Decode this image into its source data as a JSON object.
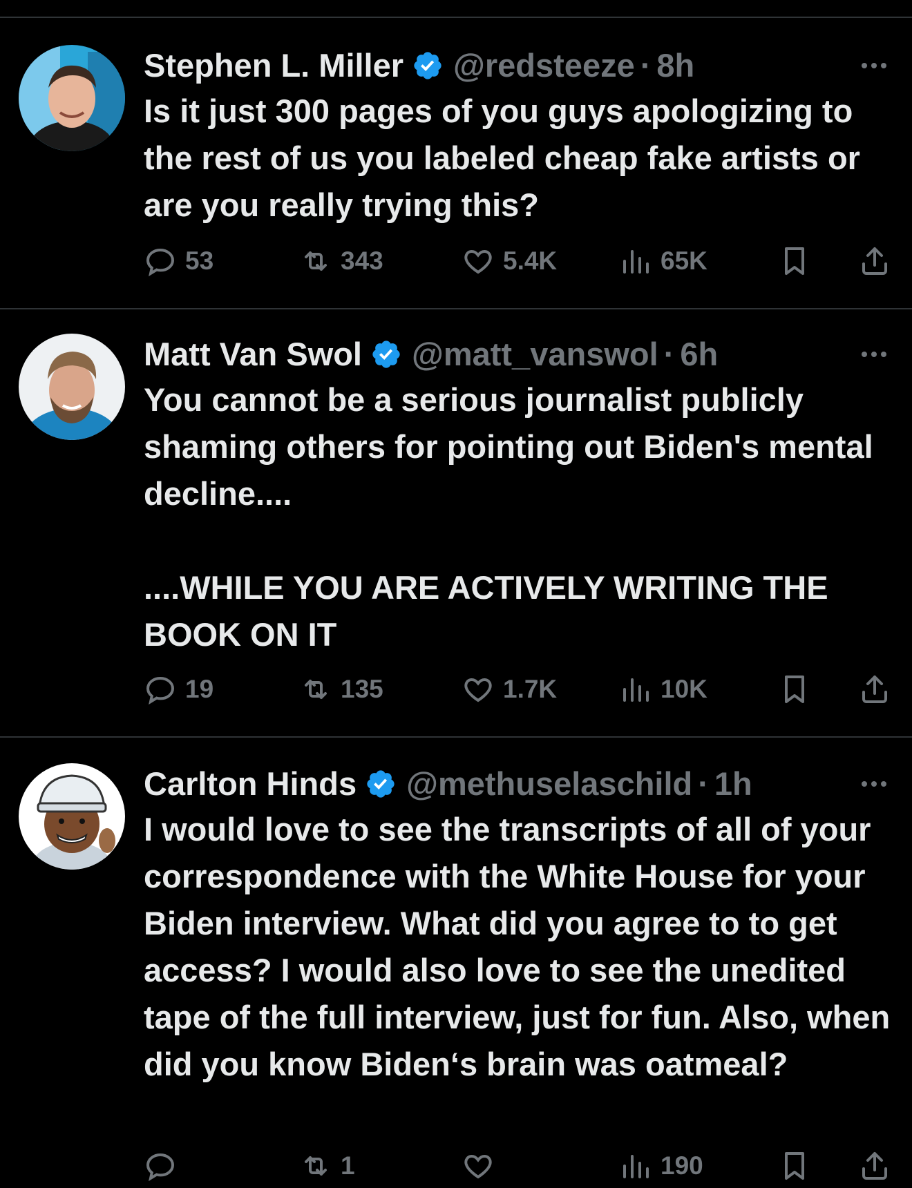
{
  "tweets": [
    {
      "name": "Stephen L. Miller",
      "handle": "@redsteeze",
      "time": "8h",
      "text": "Is it just 300 pages of you guys apologizing to the rest of us you labeled cheap fake artists or are you really trying this?",
      "replies": "53",
      "reposts": "343",
      "likes": "5.4K",
      "views": "65K"
    },
    {
      "name": "Matt Van Swol",
      "handle": "@matt_vanswol",
      "time": "6h",
      "text": "You cannot be a serious journalist publicly shaming others for pointing out Biden's mental decline....\n\n....WHILE YOU ARE ACTIVELY WRITING THE BOOK ON IT",
      "replies": "19",
      "reposts": "135",
      "likes": "1.7K",
      "views": "10K"
    },
    {
      "name": "Carlton Hinds",
      "handle": "@methuselaschild",
      "time": "1h",
      "text": "I would love to see the transcripts of all of your correspondence with the White House for your Biden interview. What did you agree to to get access? I would also love to see the unedited tape of the full interview, just for fun. Also, when did you know Biden‘s brain was oatmeal?",
      "replies": "",
      "reposts": "1",
      "likes": "",
      "views": "190"
    }
  ],
  "separator": "·",
  "colors": {
    "background": "#000000",
    "text": "#e7e9ea",
    "secondary": "#71767b",
    "verified": "#1d9bf0",
    "divider": "#2f3336"
  },
  "icons": {
    "reply": "reply-icon",
    "repost": "repost-icon",
    "like": "heart-icon",
    "views": "views-icon",
    "bookmark": "bookmark-icon",
    "share": "share-icon",
    "more": "more-icon",
    "verified": "verified-badge-icon"
  }
}
